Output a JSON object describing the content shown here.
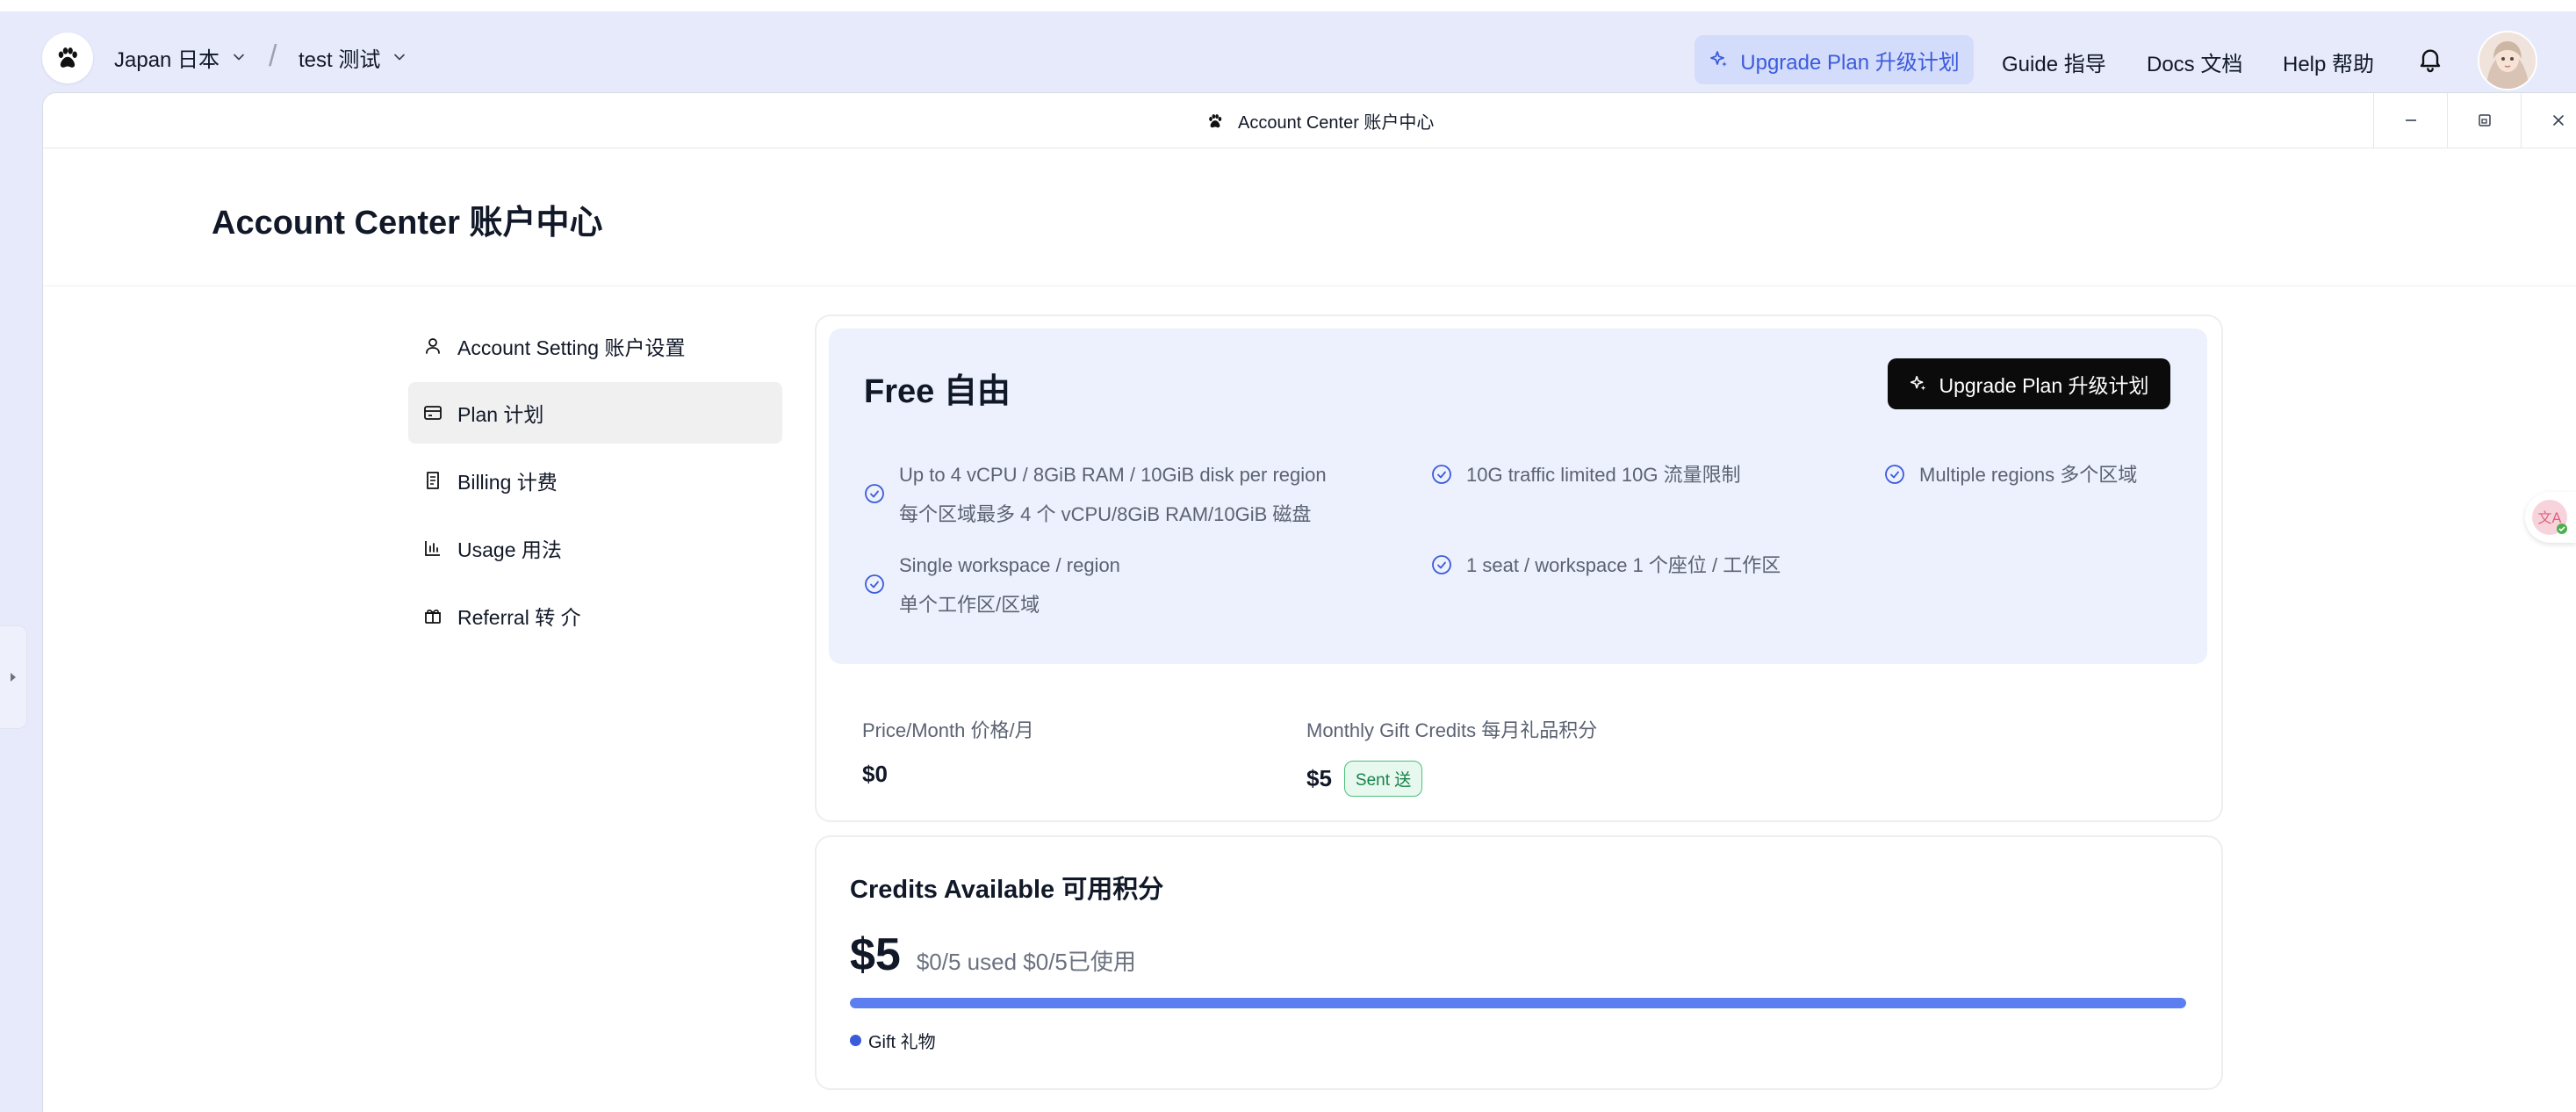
{
  "topbar": {
    "region": "Japan 日本",
    "workspace": "test 测试",
    "upgrade": "Upgrade Plan 升级计划",
    "guide": "Guide 指导",
    "docs": "Docs 文档",
    "help": "Help 帮助"
  },
  "window": {
    "title": "Account Center 账户中心"
  },
  "page": {
    "title": "Account Center 账户中心"
  },
  "sidebar": {
    "items": [
      {
        "label": "Account Setting 账户设置",
        "icon": "user-icon"
      },
      {
        "label": "Plan 计划",
        "icon": "credit-card-icon",
        "active": true
      },
      {
        "label": "Billing 计费",
        "icon": "receipt-icon"
      },
      {
        "label": "Usage 用法",
        "icon": "bar-chart-icon"
      },
      {
        "label": "Referral 转 介",
        "icon": "gift-icon"
      }
    ]
  },
  "plan": {
    "name": "Free 自由",
    "upgrade": "Upgrade Plan 升级计划",
    "features": [
      {
        "en": "Up to 4 vCPU / 8GiB RAM / 10GiB disk per region",
        "zh": "每个区域最多 4 个 vCPU/8GiB RAM/10GiB 磁盘"
      },
      {
        "text": "10G traffic limited 10G 流量限制"
      },
      {
        "text": "Multiple regions 多个区域"
      },
      {
        "en": "Single workspace / region",
        "zh": "单个工作区/区域"
      },
      {
        "text": "1 seat / workspace 1 个座位 / 工作区"
      }
    ],
    "price_label": "Price/Month 价格/月",
    "price_value": "$0",
    "gift_label": "Monthly Gift Credits 每月礼品积分",
    "gift_value": "$5",
    "gift_badge": "Sent 送"
  },
  "credits": {
    "title": "Credits Available 可用积分",
    "amount": "$5",
    "usage": "$0/5 used $0/5已使用",
    "legend": "Gift 礼物",
    "fill_percent": 100,
    "accent": "#5b7ef1"
  }
}
